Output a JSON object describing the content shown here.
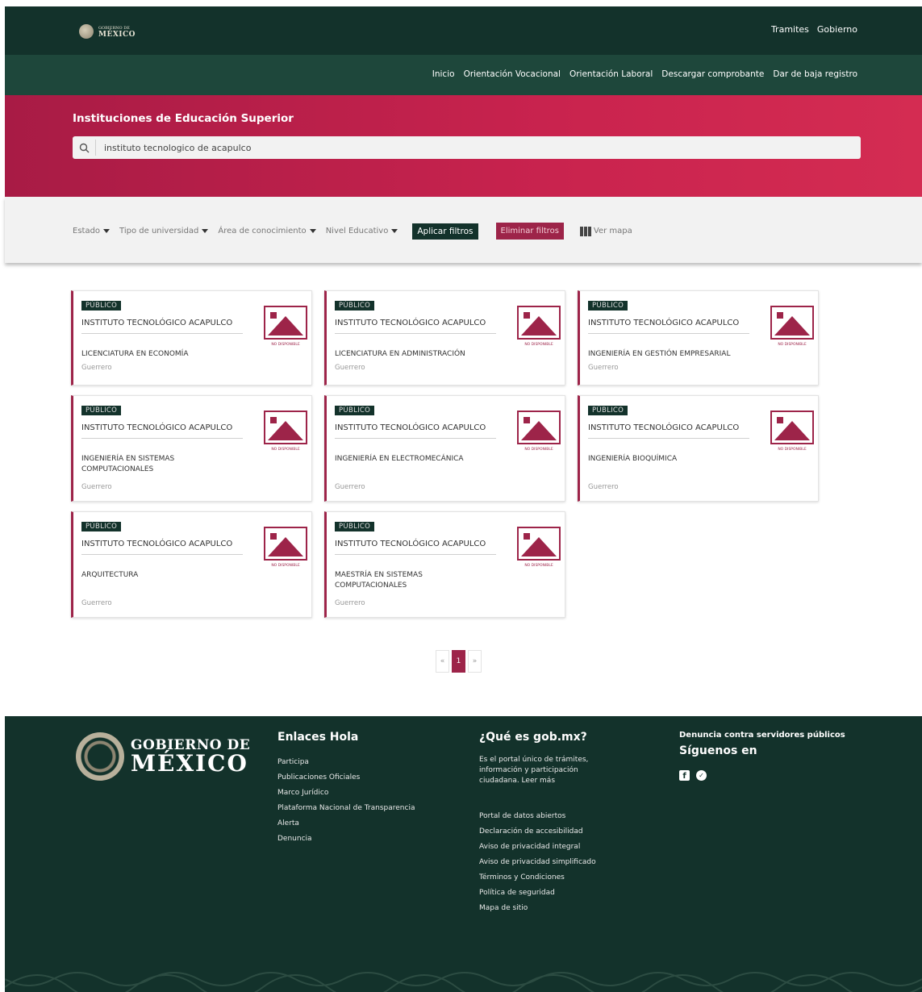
{
  "header": {
    "logo_line1": "GOBIERNO DE",
    "logo_line2": "MÉXICO",
    "top_links": [
      "Tramites",
      "Gobierno"
    ],
    "nav_links": [
      "Inicio",
      "Orientación Vocacional",
      "Orientación Laboral",
      "Descargar comprobante",
      "Dar de baja registro"
    ]
  },
  "hero": {
    "title": "Instituciones de Educación Superior",
    "search_value": "instituto tecnologico de acapulco"
  },
  "filters": {
    "estado": "Estado",
    "tipo": "Tipo de universidad",
    "area": "Área de conocimiento",
    "nivel": "Nivel Educativo",
    "apply": "Aplicar filtros",
    "clear": "Eliminar filtros",
    "map": "Ver mapa"
  },
  "cards": [
    {
      "badge": "PÚBLICO",
      "institution": "INSTITUTO TECNOLÓGICO ACAPULCO",
      "career": "LICENCIATURA EN ECONOMÍA",
      "state": "Guerrero",
      "img_caption": "NO DISPONIBLE"
    },
    {
      "badge": "PÚBLICO",
      "institution": "INSTITUTO TECNOLÓGICO ACAPULCO",
      "career": "LICENCIATURA EN ADMINISTRACIÓN",
      "state": "Guerrero",
      "img_caption": "NO DISPONIBLE"
    },
    {
      "badge": "PÚBLICO",
      "institution": "INSTITUTO TECNOLÓGICO ACAPULCO",
      "career": "INGENIERÍA EN GESTIÓN EMPRESARIAL",
      "state": "Guerrero",
      "img_caption": "NO DISPONIBLE"
    },
    {
      "badge": "PÚBLICO",
      "institution": "INSTITUTO TECNOLÓGICO ACAPULCO",
      "career": "INGENIERÍA EN SISTEMAS COMPUTACIONALES",
      "state": "Guerrero",
      "img_caption": "NO DISPONIBLE"
    },
    {
      "badge": "PÚBLICO",
      "institution": "INSTITUTO TECNOLÓGICO ACAPULCO",
      "career": "INGENIERÍA EN ELECTROMECÁNICA",
      "state": "Guerrero",
      "img_caption": "NO DISPONIBLE"
    },
    {
      "badge": "PÚBLICO",
      "institution": "INSTITUTO TECNOLÓGICO ACAPULCO",
      "career": "INGENIERÍA BIOQUÍMICA",
      "state": "Guerrero",
      "img_caption": "NO DISPONIBLE"
    },
    {
      "badge": "PÚBLICO",
      "institution": "INSTITUTO TECNOLÓGICO ACAPULCO",
      "career": "ARQUITECTURA",
      "state": "Guerrero",
      "img_caption": "NO DISPONIBLE"
    },
    {
      "badge": "PÚBLICO",
      "institution": "INSTITUTO TECNOLÓGICO ACAPULCO",
      "career": "MAESTRÍA EN SISTEMAS COMPUTACIONALES",
      "state": "Guerrero",
      "img_caption": "NO DISPONIBLE"
    }
  ],
  "pagination": {
    "prev": "«",
    "current": "1",
    "next": "»"
  },
  "footer": {
    "logo_line1": "GOBIERNO DE",
    "logo_line2": "MÉXICO",
    "col1_title": "Enlaces Hola",
    "col1_links": [
      "Participa",
      "Publicaciones Oficiales",
      "Marco Jurídico",
      "Plataforma Nacional de Transparencia",
      "Alerta",
      "Denuncia"
    ],
    "col2_title": "¿Qué es gob.mx?",
    "col2_text": "Es el portal único de trámites, información y participación ciudadana. Leer más",
    "col2_links": [
      "Portal de datos abiertos",
      "Declaración de accesibilidad",
      "Aviso de privacidad integral",
      "Aviso de privacidad simplificado",
      "Términos y Condiciones",
      "Política de seguridad",
      "Mapa de sitio"
    ],
    "col3_title": "Denuncia contra servidores públicos",
    "col3_subtitle": "Síguenos en"
  },
  "colors": {
    "dark_green": "#13322b",
    "nav_green": "#1e473b",
    "guinda": "#9d2449",
    "hero_red": "#c9234e"
  }
}
